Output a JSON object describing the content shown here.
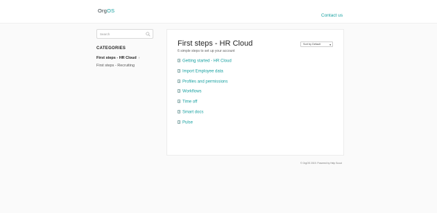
{
  "header": {
    "logo_org": "Org",
    "logo_os": "OS",
    "contact_label": "Contact us"
  },
  "sidebar": {
    "search_placeholder": "Search",
    "categories_title": "CATEGORIES",
    "categories": [
      {
        "label": "First steps - HR Cloud",
        "active": true
      },
      {
        "label": "First steps - Recruiting",
        "active": false
      }
    ]
  },
  "main": {
    "title": "First steps - HR Cloud",
    "subtitle": "6 simple steps to set up your account",
    "sort_label": "Sort by Default",
    "articles": [
      "Getting started - HR Cloud",
      "Import Employee data",
      "Profiles and permissions",
      "Workflows",
      "Time off",
      "Smart docs",
      "Pulse"
    ]
  },
  "footer": {
    "text": "© OrgOS 2019. Powered by Help Scout"
  },
  "colors": {
    "accent": "#16a0a0",
    "text_dark": "#222222",
    "background": "#fafafa"
  }
}
